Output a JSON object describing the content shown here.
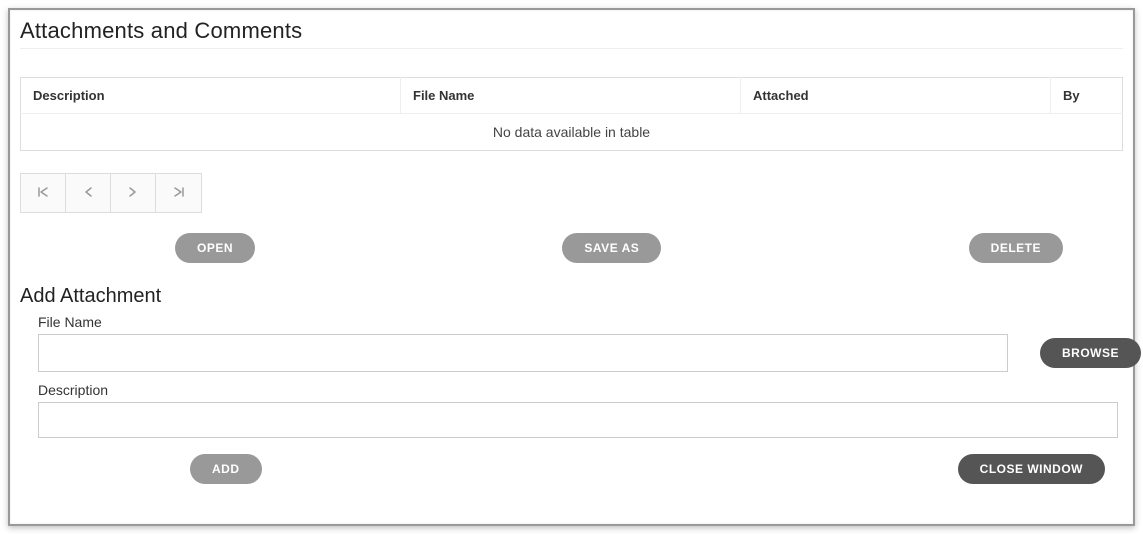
{
  "title": "Attachments and Comments",
  "table": {
    "columns": [
      "Description",
      "File Name",
      "Attached",
      "By"
    ],
    "rows": [],
    "empty_message": "No data available in table"
  },
  "pagination": {
    "first": "❘〈",
    "prev": "〈",
    "next": "〉",
    "last": "〉❘"
  },
  "actions": {
    "open": "OPEN",
    "save_as": "SAVE AS",
    "delete": "DELETE"
  },
  "add_section": {
    "title": "Add Attachment",
    "file_label": "File Name",
    "file_value": "",
    "browse": "BROWSE",
    "desc_label": "Description",
    "desc_value": "",
    "add": "ADD",
    "close": "CLOSE WINDOW"
  }
}
